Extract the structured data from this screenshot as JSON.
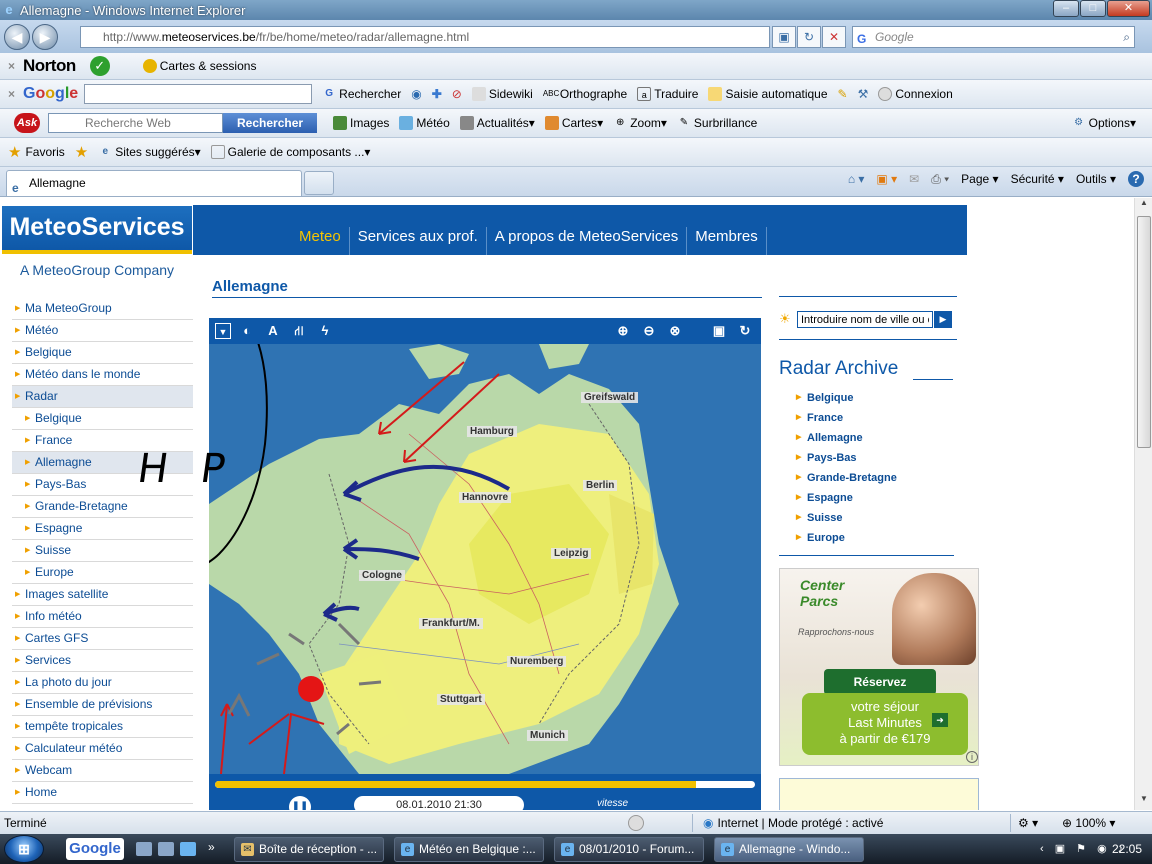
{
  "window": {
    "title": "Allemagne - Windows Internet Explorer",
    "minimize": "–",
    "maximize": "□",
    "close": "✕"
  },
  "address": {
    "url_prefix": "http://www.",
    "url_domain": "meteoservices.be",
    "url_suffix": "/fr/be/home/meteo/radar/allemagne.html",
    "search_placeholder": "Google"
  },
  "norton_toolbar": {
    "brand": "Norton",
    "safe_search": "✓",
    "identity": "Cartes & sessions"
  },
  "google_toolbar": {
    "search_btn": "Rechercher",
    "sidewiki": "Sidewiki",
    "spell": "Orthographe",
    "translate": "Traduire",
    "autofill": "Saisie automatique",
    "connect": "Connexion"
  },
  "ask_toolbar": {
    "input_placeholder": "Recherche Web",
    "search_btn": "Rechercher",
    "items": [
      "Images",
      "Météo",
      "Actualités",
      "Cartes",
      "Zoom",
      "Surbrillance"
    ],
    "options": "Options"
  },
  "favorites_bar": {
    "favorites": "Favoris",
    "suggested": "Sites suggérés",
    "gallery": "Galerie de composants ..."
  },
  "tabs": {
    "active_label": "Allemagne",
    "commands": [
      "Page",
      "Sécurité",
      "Outils"
    ]
  },
  "site": {
    "logo": "MeteoServices",
    "tagline": "A MeteoGroup Company",
    "nav": [
      "Meteo",
      "Services aux prof.",
      "A propos de MeteoServices",
      "Membres"
    ],
    "left_menu": [
      {
        "label": "Ma MeteoGroup"
      },
      {
        "label": "Météo"
      },
      {
        "label": "Belgique"
      },
      {
        "label": "Météo dans le monde"
      },
      {
        "label": "Radar"
      },
      {
        "label": "Belgique"
      },
      {
        "label": "France"
      },
      {
        "label": "Allemagne"
      },
      {
        "label": "Pays-Bas"
      },
      {
        "label": "Grande-Bretagne"
      },
      {
        "label": "Espagne"
      },
      {
        "label": "Suisse"
      },
      {
        "label": "Europe"
      },
      {
        "label": "Images satellite"
      },
      {
        "label": "Info météo"
      },
      {
        "label": "Cartes GFS"
      },
      {
        "label": "Services"
      },
      {
        "label": "La photo du jour"
      },
      {
        "label": "Ensemble de prévisions"
      },
      {
        "label": "tempête tropicales"
      },
      {
        "label": "Calculateur météo"
      },
      {
        "label": "Webcam"
      },
      {
        "label": "Home"
      }
    ],
    "page_title": "Allemagne",
    "map": {
      "cities": [
        "Greifswald",
        "Hamburg",
        "Berlin",
        "Hannovre",
        "Leipzig",
        "Cologne",
        "Frankfurt/M.",
        "Nuremberg",
        "Stuttgart",
        "Munich"
      ],
      "annotation": "H P",
      "timestamp": "08.01.2010 21:30",
      "speed_label": "vitesse",
      "progress": 0.89
    },
    "city_search_placeholder": "Introduire nom de ville ou code postal",
    "archive": {
      "title": "Radar Archive",
      "items": [
        "Belgique",
        "France",
        "Allemagne",
        "Pays-Bas",
        "Grande-Bretagne",
        "Espagne",
        "Suisse",
        "Europe"
      ]
    },
    "ad": {
      "brand": "Center Parcs",
      "tagline": "Rapprochons-nous",
      "cta": "Réservez maintenant",
      "offer_line1": "votre séjour",
      "offer_line2": "Last Minutes",
      "offer_line3": "à partir de €179"
    }
  },
  "status": {
    "left": "Terminé",
    "zone": "Internet | Mode protégé : activé",
    "zoom": "100%"
  },
  "taskbar": {
    "google": "Google",
    "tasks": [
      "Boîte de réception - ...",
      "Météo en Belgique :...",
      "08/01/2010 - Forum...",
      "Allemagne - Windo..."
    ],
    "clock": "22:05"
  },
  "colors": {
    "brand_blue": "#0e58a8",
    "accent_yellow": "#f0c000"
  }
}
